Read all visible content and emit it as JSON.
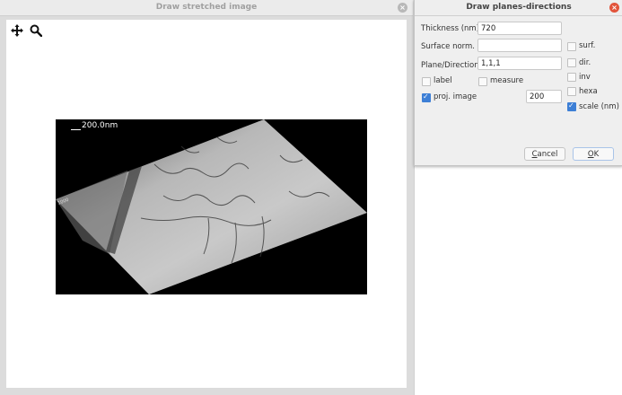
{
  "left_window": {
    "title": "Draw stretched image",
    "scale_label": "200.0nm"
  },
  "dialog": {
    "title": "Draw planes-directions",
    "thickness_label": "Thickness (nm)",
    "thickness_value": "720",
    "surface_norm_label": "Surface norm.",
    "surface_norm_value": "",
    "plane_direction_label": "Plane/Direction",
    "plane_direction_value": "1,1,1",
    "label_cb": "label",
    "measure_cb": "measure",
    "proj_image_cb": "proj. image",
    "proj_image_value": "200",
    "surf_cb": "surf.",
    "dir_cb": "dir.",
    "inv_cb": "inv",
    "hexa_cb": "hexa",
    "scale_cb": "scale (nm)",
    "cancel_first": "C",
    "cancel_rest": "ancel",
    "ok_first": "O",
    "ok_rest": "K",
    "checked": {
      "label": false,
      "measure": false,
      "proj_image": true,
      "surf": false,
      "dir": false,
      "inv": false,
      "hexa": false,
      "scale": true
    }
  },
  "icons": {
    "move": "move-icon",
    "zoom": "magnifier-icon",
    "close": "close-icon"
  },
  "colors": {
    "accent": "#3d7fd6",
    "close_active": "#e2543b"
  }
}
